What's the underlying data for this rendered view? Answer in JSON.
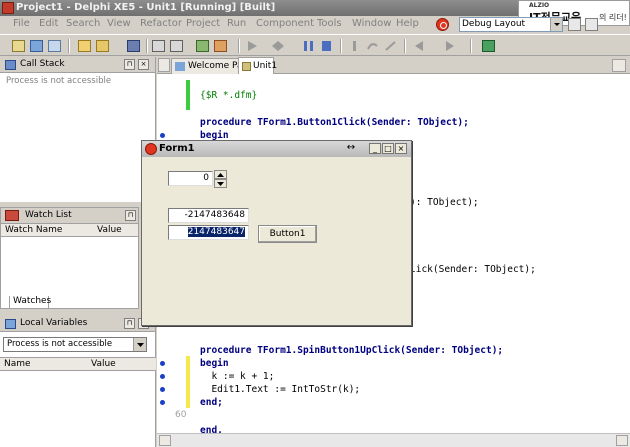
{
  "window": {
    "title": "Project1 - Delphi XE5 - Unit1 [Running] [Built]"
  },
  "advert": {
    "brand": "ALZIO",
    "main": "IT전문교육",
    "sub": "의 리더!"
  },
  "menu": [
    "File",
    "Edit",
    "Search",
    "View",
    "Refactor",
    "Project",
    "Run",
    "Component",
    "Tools",
    "Window",
    "Help"
  ],
  "layout_combo": {
    "value": "Debug Layout"
  },
  "tabs": [
    "Welcome Page",
    "Unit1"
  ],
  "call_stack": {
    "title": "Call Stack",
    "message": "Process is not accessible"
  },
  "watch_list": {
    "title": "Watch List",
    "columns": [
      "Watch Name",
      "Value"
    ],
    "tab": "Watches"
  },
  "local_variables": {
    "title": "Local Variables",
    "process_select": "Process is not accessible",
    "columns": [
      "Name",
      "Value"
    ]
  },
  "code": {
    "lines": [
      "{$R *.dfm}",
      "procedure TForm1.Button1Click(Sender: TObject);",
      "begin",
      "): TObject);",
      "lick(Sender: TObject);",
      "procedure TForm1.SpinButton1UpClick(Sender: TObject);",
      "begin",
      "  k := k + 1;",
      "  Edit1.Text := IntToStr(k);",
      "end;",
      "end."
    ],
    "line_number": "60"
  },
  "form1": {
    "title": "Form1",
    "spin_value": "0",
    "edit1": "-2147483648",
    "edit2": "2147483647",
    "button1": "Button1"
  }
}
